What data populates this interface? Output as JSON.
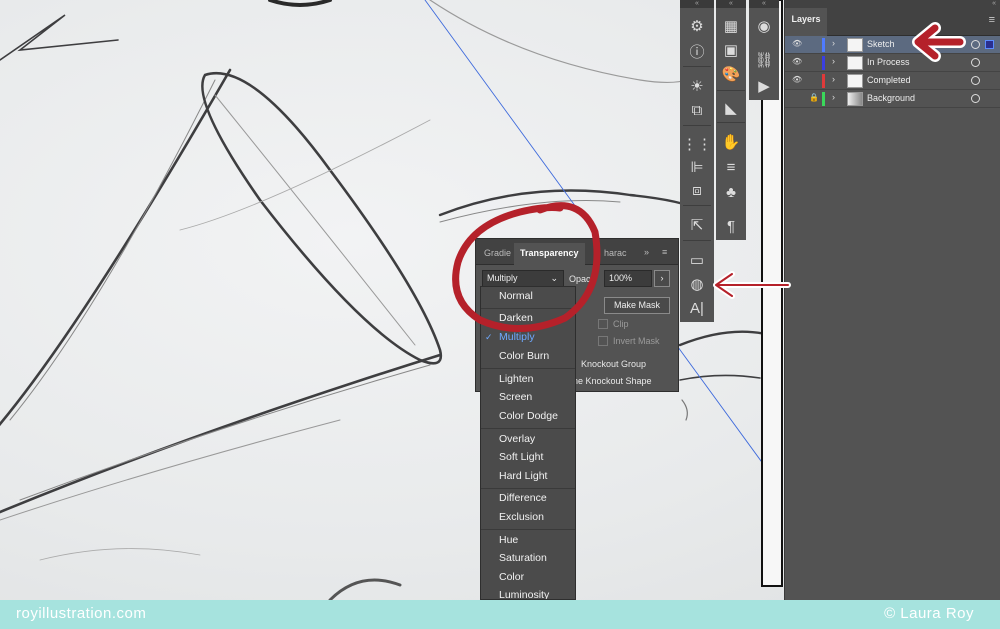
{
  "layers_panel": {
    "tab": "Layers",
    "rows": [
      {
        "name": "Sketch",
        "color": "#4f7bff",
        "visible": true,
        "locked": false,
        "selected": true
      },
      {
        "name": "In Process",
        "color": "#3a3fe0",
        "visible": true,
        "locked": false,
        "selected": false
      },
      {
        "name": "Completed",
        "color": "#e03a3a",
        "visible": true,
        "locked": false,
        "selected": false
      },
      {
        "name": "Background",
        "color": "#3ad85a",
        "visible": false,
        "locked": true,
        "selected": false
      }
    ]
  },
  "transparency_panel": {
    "tabs": [
      "Gradie",
      "Transparency",
      "harac"
    ],
    "blend_mode": "Multiply",
    "opacity_label": "Opac",
    "opacity_value": "100%",
    "make_mask": "Make Mask",
    "clip": "Clip",
    "invert_mask": "Invert Mask",
    "knockout_group": "Knockout Group",
    "knockout_shape": "ne Knockout Shape"
  },
  "blend_menu": {
    "items": [
      "Normal",
      "Darken",
      "Multiply",
      "Color Burn",
      "Lighten",
      "Screen",
      "Color Dodge",
      "Overlay",
      "Soft Light",
      "Hard Light",
      "Difference",
      "Exclusion",
      "Hue",
      "Saturation",
      "Color",
      "Luminosity"
    ],
    "current": "Multiply"
  },
  "footer": {
    "left": "royillustration.com",
    "right": "© Laura Roy"
  },
  "colors": {
    "panel": "#535353",
    "annotation_red": "#b5212a",
    "footer": "#a6e3de"
  },
  "icons": {
    "eye": "eye-icon",
    "lock": "lock-icon",
    "chevron": "chevron-right-icon",
    "transparency_tool": "transparency-icon"
  }
}
